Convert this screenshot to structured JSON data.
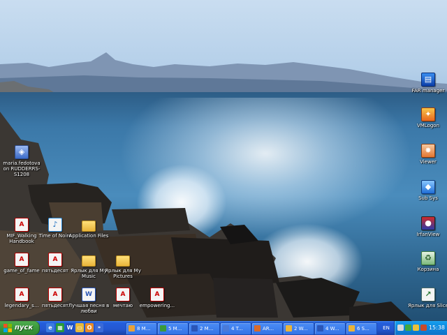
{
  "desktop": {
    "icons_left": [
      {
        "name": "user-file-icon",
        "label": "maria.fedotova on RUDDERRS-S1208",
        "glyph": "user"
      },
      {
        "name": "pdf-file-icon",
        "label": "MIF_Walking Handbook",
        "glyph": "pdf"
      },
      {
        "name": "music-file-icon",
        "label": "Time of Noire",
        "glyph": "music"
      },
      {
        "name": "folder-icon",
        "label": "Application Files",
        "glyph": "folder"
      },
      {
        "name": "pdf-file-icon",
        "label": "game_of_fame",
        "glyph": "pdf"
      },
      {
        "name": "pdf-file-icon",
        "label": "пятьдесят",
        "glyph": "pdf"
      },
      {
        "name": "folder-icon",
        "label": "Ярлык для My Music",
        "glyph": "folder"
      },
      {
        "name": "shortcut-icon",
        "label": "Ярлык для My Pictures",
        "glyph": "folder"
      },
      {
        "name": "pdf-file-icon",
        "label": "legendary_s...",
        "glyph": "pdf"
      },
      {
        "name": "pdf-file-icon",
        "label": "пятьдесят",
        "glyph": "pdf"
      },
      {
        "name": "doc-file-icon",
        "label": "Лучшая песня в любви",
        "glyph": "doc"
      },
      {
        "name": "pdf-file-icon",
        "label": "мечтаю",
        "glyph": "pdf"
      },
      {
        "name": "pdf-file-icon",
        "label": "empowering...",
        "glyph": "pdf"
      }
    ],
    "icons_right": [
      {
        "name": "far-manager-icon",
        "label": "FAR manager",
        "glyph": "app1"
      },
      {
        "name": "app-icon",
        "label": "VMLogon",
        "glyph": "app2"
      },
      {
        "name": "app-icon",
        "label": "Viewer",
        "glyph": "app3"
      },
      {
        "name": "app-icon",
        "label": "Sub Sys",
        "glyph": "app4"
      },
      {
        "name": "app-icon",
        "label": "IrfanView",
        "glyph": "app5"
      },
      {
        "name": "recycle-bin-icon",
        "label": "Корзина",
        "glyph": "bin"
      },
      {
        "name": "chart-shortcut-icon",
        "label": "Ярлык для Slice",
        "glyph": "chart"
      }
    ]
  },
  "taskbar": {
    "start_label": "пуск",
    "tasks": [
      {
        "name": "task-button",
        "label": "8 M...",
        "color": "#e8a23a"
      },
      {
        "name": "task-button",
        "label": "5 M...",
        "color": "#3a9a3a"
      },
      {
        "name": "task-button",
        "label": "2 M...",
        "color": "#2a56b8"
      },
      {
        "name": "task-button",
        "label": "4 T...",
        "color": "#4a7ad8"
      },
      {
        "name": "task-button",
        "label": "AR...",
        "color": "#d86a2a"
      },
      {
        "name": "task-button",
        "label": "2 W...",
        "color": "#e9b43a"
      },
      {
        "name": "task-button",
        "label": "4 W...",
        "color": "#2a56b8"
      },
      {
        "name": "task-button",
        "label": "6 S...",
        "color": "#e9b43a"
      }
    ],
    "language": "EN",
    "clock": "15:38"
  }
}
